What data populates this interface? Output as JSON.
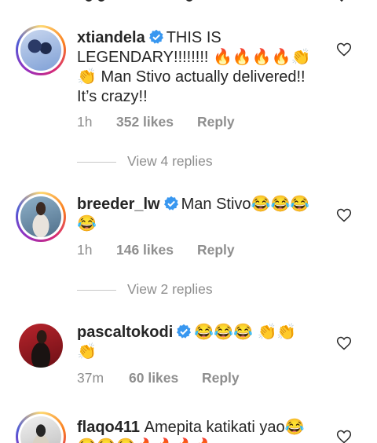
{
  "comments": [
    {
      "username": "xtiandela",
      "text": "THIS IS LEGENDARY!!!!!!!! 🔥🔥🔥🔥👏 👏 Man Stivo actually delivered!! It’s crazy!!",
      "time": "1h",
      "likes": "352 likes",
      "reply_label": "Reply",
      "view_replies": "View 4 replies",
      "verified": true
    },
    {
      "username": "breeder_lw",
      "text": "Man Stivo😂😂😂 😂",
      "time": "1h",
      "likes": "146 likes",
      "reply_label": "Reply",
      "view_replies": "View 2 replies",
      "verified": true
    },
    {
      "username": "pascaltokodi",
      "text": "😂😂😂 👏👏 👏",
      "time": "37m",
      "likes": "60 likes",
      "reply_label": "Reply",
      "verified": true
    },
    {
      "username": "flaqo411",
      "text": "Amepita katikati yao😂 😂😂😂🔥🔥🔥🔥",
      "verified": false
    }
  ],
  "colors": {
    "text": "#262626",
    "muted": "#8e8e8e",
    "verified": "#3897f0"
  },
  "icons": {
    "heart": "heart-outline-icon",
    "verified": "verified-badge-icon"
  }
}
